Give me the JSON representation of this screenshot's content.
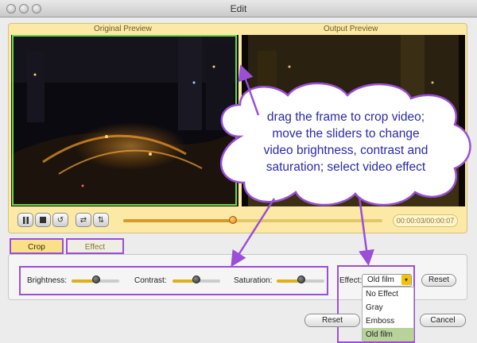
{
  "window": {
    "title": "Edit"
  },
  "preview": {
    "original_label": "Original Preview",
    "output_label": "Output Preview"
  },
  "playback": {
    "buttons": [
      "play-pause",
      "stop",
      "rewind",
      "swap-horizontal",
      "swap-vertical"
    ],
    "progress": 0.44,
    "timecode": "00:00:03/00:00:07"
  },
  "tabs": [
    {
      "label": "Crop"
    },
    {
      "label": "Effect"
    }
  ],
  "adjustments": {
    "brightness_label": "Brightness:",
    "brightness_value": 0.52,
    "contrast_label": "Contrast:",
    "contrast_value": 0.5,
    "saturation_label": "Saturation:",
    "saturation_value": 0.52
  },
  "effect": {
    "label": "Effect:",
    "selected": "Old film",
    "options": [
      "No Effect",
      "Gray",
      "Emboss",
      "Old film"
    ],
    "reset_label": "Reset"
  },
  "footer": {
    "reset_label": "Reset",
    "cancel_label": "Cancel"
  },
  "callout": {
    "lines": [
      "drag the frame to crop video;",
      "move the sliders to change",
      "video brightness, contrast and",
      "saturation; select video effect"
    ]
  },
  "colors": {
    "annotation": "#9a4fd6",
    "crop_frame": "#6ad64a",
    "preview_bg": "#fbe9a5",
    "callout_text": "#2a2aa8"
  }
}
